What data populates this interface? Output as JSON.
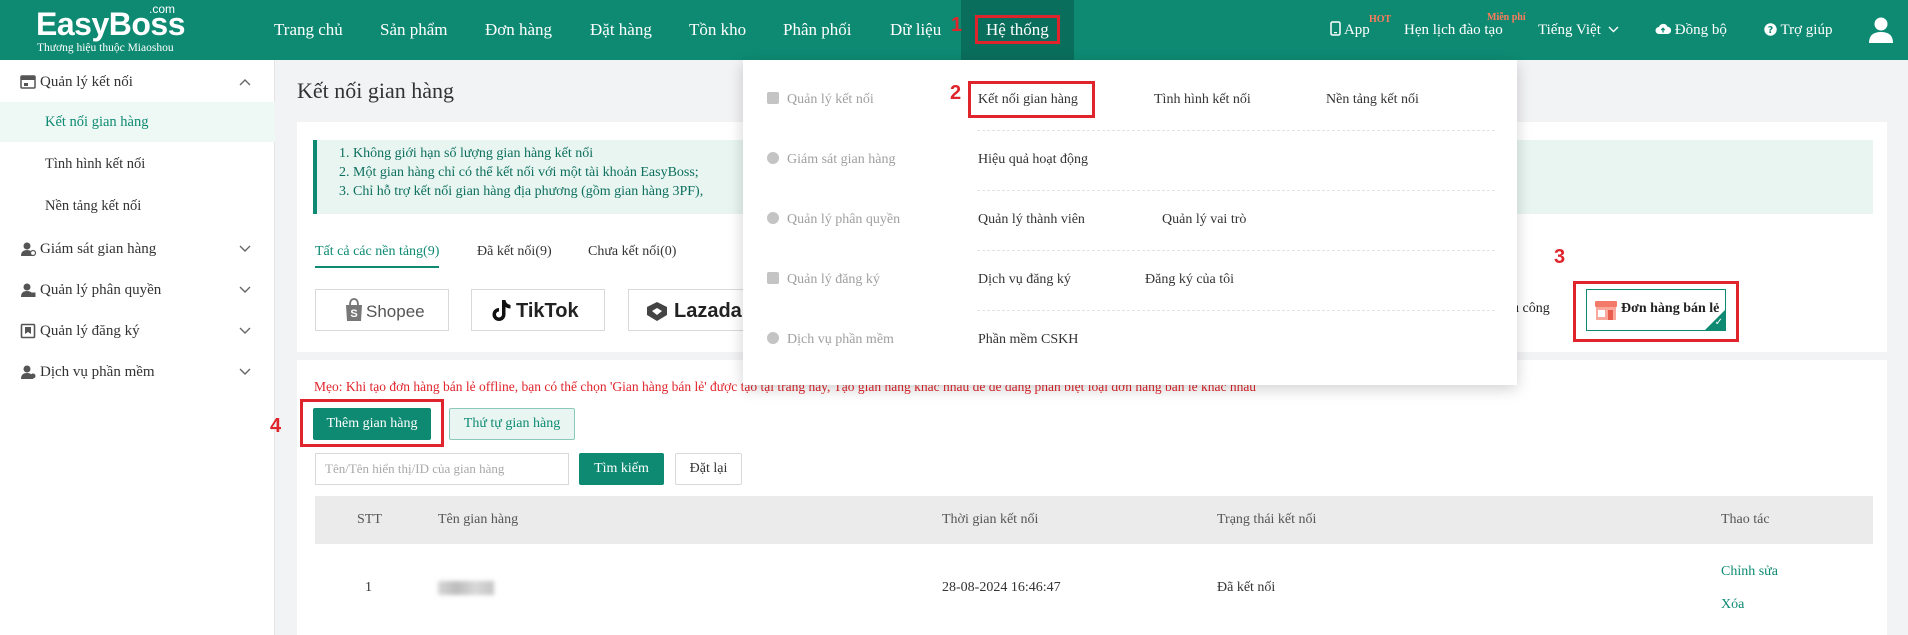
{
  "brand": {
    "name": "EasyBoss",
    "suffix": ".com",
    "tagline": "Thương hiệu thuộc Miaoshou"
  },
  "nav": [
    {
      "label": "Trang chủ"
    },
    {
      "label": "Sản phẩm"
    },
    {
      "label": "Đơn hàng"
    },
    {
      "label": "Đặt hàng"
    },
    {
      "label": "Tồn kho"
    },
    {
      "label": "Phân phối"
    },
    {
      "label": "Dữ liệu"
    },
    {
      "label": "Hệ thống"
    }
  ],
  "top_right": {
    "app": "App",
    "app_badge": "HOT",
    "training": "Hẹn lịch đào tạo",
    "training_badge": "Miễn phí",
    "language": "Tiếng Việt",
    "sync": "Đồng bộ",
    "help": "Trợ giúp"
  },
  "sidebar": {
    "groups": [
      {
        "label": "Quản lý kết nối",
        "expanded": true
      },
      {
        "label": "Giám sát gian hàng"
      },
      {
        "label": "Quản lý phân quyền"
      },
      {
        "label": "Quản lý đăng ký"
      },
      {
        "label": "Dịch vụ phần mềm"
      }
    ],
    "items": [
      "Kết nối gian hàng",
      "Tình hình kết nối",
      "Nền tảng kết nối"
    ]
  },
  "page_title": "Kết nối gian hàng",
  "notice": [
    "1. Không giới hạn số lượng gian hàng kết nối",
    "2. Một gian hàng chỉ có thể kết nối với một tài khoản EasyBoss;",
    "3. Chỉ hỗ trợ kết nối gian hàng địa phương (gồm gian hàng 3PF),"
  ],
  "tabs": [
    "Tất cả các nền tảng(9)",
    "Đã kết nối(9)",
    "Chưa kết nối(0)"
  ],
  "platforms": [
    "Shopee",
    "TikTok",
    "Lazada"
  ],
  "manual_label": "ủ công",
  "retail_label": "Đơn hàng bán lẻ",
  "tip": "Mẹo: Khi tạo đơn hàng bán lẻ offline, bạn có thể chọn 'Gian hàng bán lẻ' được tạo tại trang này, Tạo gian hàng khác nhau để dễ dàng phân biệt loại đơn hàng bán lẻ khác nhau",
  "buttons": {
    "add_store": "Thêm gian hàng",
    "store_order": "Thứ tự gian hàng",
    "search": "Tìm kiếm",
    "reset": "Đặt lại"
  },
  "search": {
    "placeholder": "Tên/Tên hiển thị/ID của gian hàng"
  },
  "table": {
    "headers": [
      "STT",
      "Tên gian hàng",
      "Thời gian kết nối",
      "Trạng thái kết nối",
      "Thao tác"
    ],
    "rows": [
      {
        "stt": "1",
        "connected_at": "28-08-2024 16:46:47",
        "status": "Đã kết nối",
        "actions": [
          "Chỉnh sửa",
          "Xóa"
        ]
      }
    ]
  },
  "dropdown": {
    "rows": [
      {
        "category": "Quản lý kết nối",
        "links": [
          "Kết nối gian hàng",
          "Tình hình kết nối",
          "Nền tảng kết nối"
        ]
      },
      {
        "category": "Giám sát gian hàng",
        "links": [
          "Hiệu quả hoạt động"
        ]
      },
      {
        "category": "Quản lý phân quyền",
        "links": [
          "Quản lý thành viên",
          "Quản lý vai trò"
        ]
      },
      {
        "category": "Quản lý đăng ký",
        "links": [
          "Dịch vụ đăng ký",
          "Đăng ký của tôi"
        ]
      },
      {
        "category": "Dịch vụ phần mềm",
        "links": [
          "Phần mềm CSKH"
        ]
      }
    ]
  },
  "steps": [
    "1",
    "2",
    "3",
    "4"
  ],
  "colors": {
    "primary": "#0e8a73",
    "highlight": "#e0242b"
  }
}
